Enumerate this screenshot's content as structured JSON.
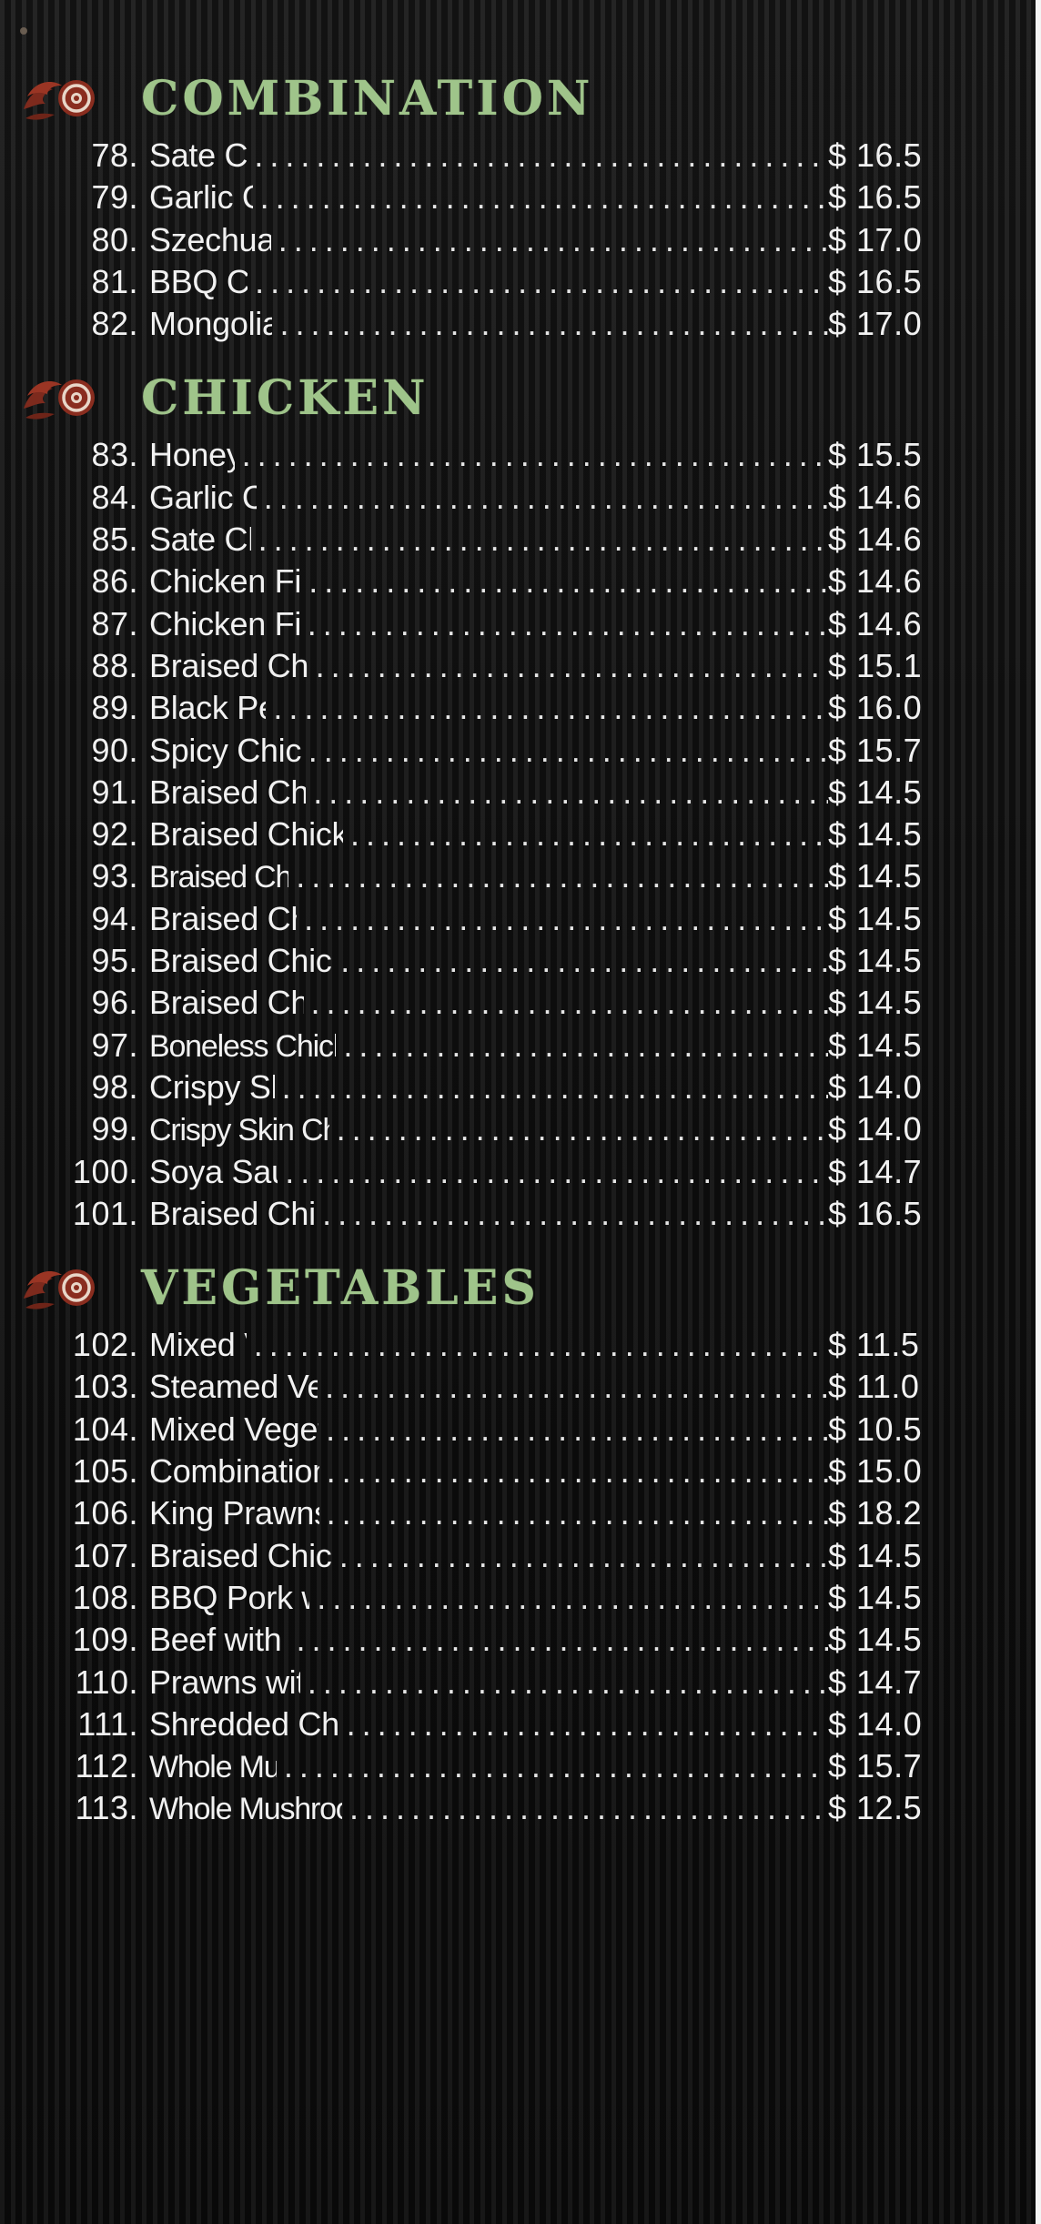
{
  "sections": [
    {
      "title": "COMBINATION",
      "items": [
        {
          "num": "78.",
          "name": "Sate Combination",
          "price": "$ 16.5"
        },
        {
          "num": "79.",
          "name": "Garlic Combination",
          "price": "$ 16.5"
        },
        {
          "num": "80.",
          "name": "Szechuan Combination",
          "price": "$ 17.0"
        },
        {
          "num": "81.",
          "name": "BBQ Combination",
          "price": "$ 16.5"
        },
        {
          "num": "82.",
          "name": "Mongolian Combination",
          "price": "$ 17.0"
        }
      ]
    },
    {
      "title": "CHICKEN",
      "items": [
        {
          "num": "83.",
          "name": "Honey Chicken",
          "price": "$ 15.5"
        },
        {
          "num": "84.",
          "name": "Garlic Chicken Fillet",
          "price": "$ 14.6"
        },
        {
          "num": "85.",
          "name": "Sate Chicken Fillet",
          "price": "$ 14.6"
        },
        {
          "num": "86.",
          "name": "Chicken Fillet with Plum Sauce",
          "price": "$ 14.6"
        },
        {
          "num": "87.",
          "name": "Chicken Fillet with BBQ Sauce",
          "price": "$ 14.6"
        },
        {
          "num": "88.",
          "name": "Braised Chicken Szechuan Style",
          "price": "$ 15.1"
        },
        {
          "num": "89.",
          "name": "Black Pepper Chicken",
          "price": "$ 16.0"
        },
        {
          "num": "90.",
          "name": "Spicy Chicken (Salt and Spicy)",
          "price": "$ 15.7"
        },
        {
          "num": "91.",
          "name": "Braised Chicken and Mushroom",
          "price": "$ 14.5"
        },
        {
          "num": "92.",
          "name": "Braised Chicken with Almonds or Cashews",
          "price": "$ 14.5"
        },
        {
          "num": "93.",
          "name": "Braised Chicken and Mini Corn",
          "price": "$ 14.5"
        },
        {
          "num": "94.",
          "name": "Braised Chicken Combination",
          "price": "$ 14.5"
        },
        {
          "num": "95.",
          "name": "Braised Chicken and Black Bean Sauce",
          "price": "$ 14.5"
        },
        {
          "num": "96.",
          "name": "Braised Chicken and Pineapple",
          "price": "$ 14.5"
        },
        {
          "num": "97.",
          "name": "Boneless Chicken with Lemon or Plum Sauce",
          "price": "$ 14.5"
        },
        {
          "num": "98.",
          "name": "Crispy Skin Chicken (½)",
          "price": "$ 14.0"
        },
        {
          "num": "99.",
          "name": "Crispy Skin Chicken (½) with Lemon Sauce",
          "price": "$ 14.0"
        },
        {
          "num": "100.",
          "name": "Soya Sauce Chicken (½)",
          "price": "$ 14.7"
        },
        {
          "num": "101.",
          "name": "Braised Chicken with ginger sauce",
          "price": "$ 16.5"
        }
      ]
    },
    {
      "title": "VEGETABLES",
      "items": [
        {
          "num": "102.",
          "name": "Mixed Vegetables",
          "price": "$ 11.5"
        },
        {
          "num": "103.",
          "name": "Steamed Vegetables Chinese Style",
          "price": "$ 11.0"
        },
        {
          "num": "104.",
          "name": "Mixed Vegetables with Curry Sauce",
          "price": "$ 10.5"
        },
        {
          "num": "105.",
          "name": "Combination with Mixed Vegetables",
          "price": "$ 15.0"
        },
        {
          "num": "106.",
          "name": "King Prawns with Mixed Vegetables",
          "price": "$ 18.2"
        },
        {
          "num": "107.",
          "name": "Braised Chicken with Mixed Vegetables",
          "price": "$ 14.5"
        },
        {
          "num": "108.",
          "name": "BBQ Pork with Mixed Vegetables",
          "price": "$ 14.5"
        },
        {
          "num": "109.",
          "name": "Beef with Mixed Vegetables",
          "price": "$ 14.5"
        },
        {
          "num": "110.",
          "name": "Prawns with Mixed Vegetables",
          "price": "$ 14.7"
        },
        {
          "num": "111.",
          "name": "Shredded Chicken with Mixed Vegetables",
          "price": "$ 14.0"
        },
        {
          "num": "112.",
          "name": "Whole Mushroom with Beef",
          "price": "$ 15.7"
        },
        {
          "num": "113.",
          "name": "Whole Mushroom with Vegetable (only Broccoli)",
          "price": "$ 12.5"
        }
      ]
    }
  ],
  "icons": {
    "section": "flame-swirl-icon"
  },
  "colors": {
    "title": "#9fc48a",
    "text": "#f1f1f1",
    "background": "#111111",
    "icon": "#8a2d1f"
  }
}
